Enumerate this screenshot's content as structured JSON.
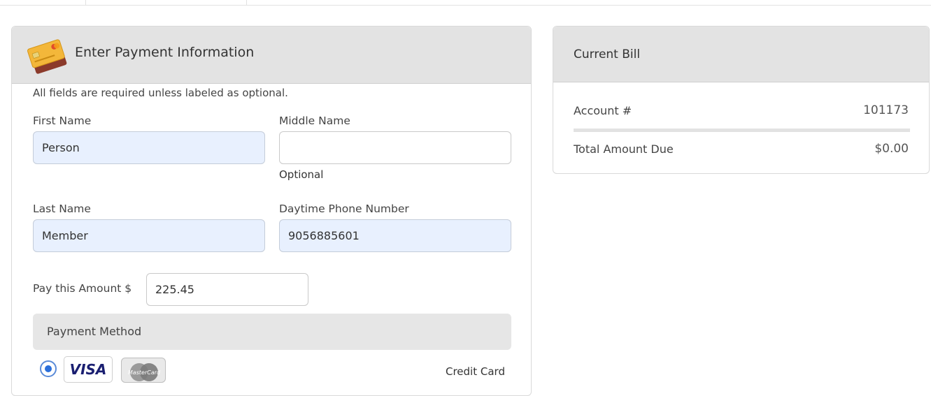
{
  "payment": {
    "title": "Enter Payment Information",
    "card_icon": "credit-cards-icon",
    "required_note": "All fields are required unless labeled as optional.",
    "first_name": {
      "label": "First Name",
      "value": "Person"
    },
    "middle_name": {
      "label": "Middle Name",
      "value": "",
      "help": "Optional"
    },
    "last_name": {
      "label": "Last Name",
      "value": "Member"
    },
    "phone": {
      "label": "Daytime Phone Number",
      "value": "9056885601"
    },
    "amount": {
      "label": "Pay this Amount $",
      "value": "225.45"
    },
    "method": {
      "title": "Payment Method",
      "visa_label": "VISA",
      "mastercard_label": "MasterCard",
      "option_label": "Credit Card",
      "selected": true
    }
  },
  "bill": {
    "title": "Current Bill",
    "account_label": "Account #",
    "account_value": "101173",
    "total_label": "Total Amount Due",
    "total_value": "$0.00"
  },
  "colors": {
    "panel_header": "#e3e3e3",
    "autofill_bg": "#e8f0fe",
    "radio_accent": "#2a6fdb",
    "visa_blue": "#1a1f71"
  }
}
